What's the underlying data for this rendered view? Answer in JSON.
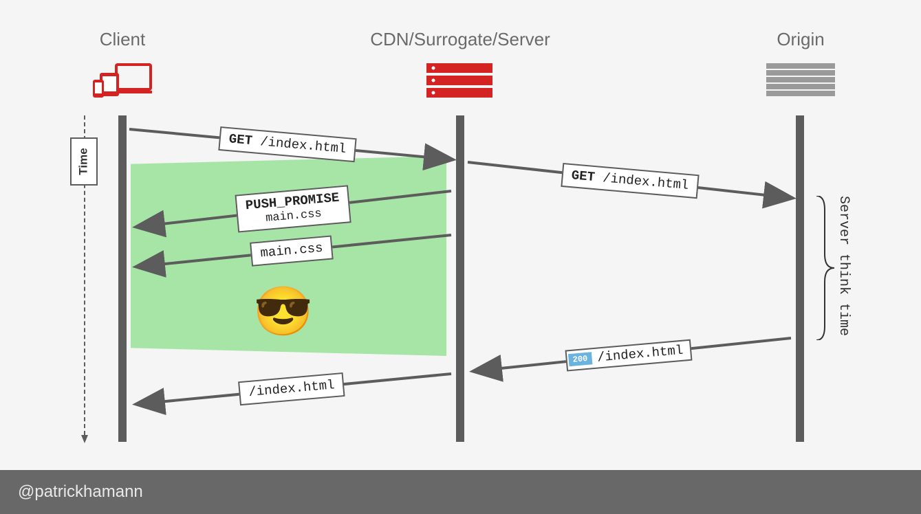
{
  "headers": {
    "client": "Client",
    "cdn": "CDN/Surrogate/Server",
    "origin": "Origin"
  },
  "axis": {
    "time_label": "Time",
    "server_think_label": "Server think time"
  },
  "messages": {
    "m1": {
      "method": "GET",
      "path": "/index.html"
    },
    "m2": {
      "method": "GET",
      "path": "/index.html"
    },
    "m3": {
      "title": "PUSH_PROMISE",
      "sub": "main.css"
    },
    "m4": {
      "label": "main.css"
    },
    "m5": {
      "status": "200",
      "path": "/index.html"
    },
    "m6": {
      "path": "/index.html"
    }
  },
  "emoji": "😎",
  "footer": {
    "handle": "@patrickhamann"
  }
}
